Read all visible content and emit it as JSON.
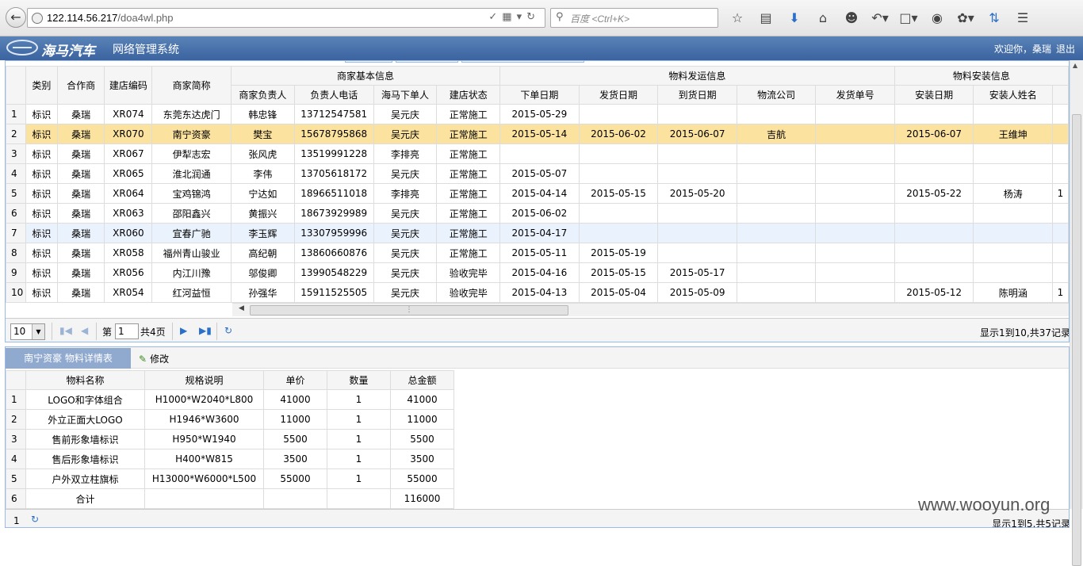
{
  "browser": {
    "url_host": "122.114.56.217",
    "url_path": "/doa4wl.php",
    "search_placeholder": "百度 <Ctrl+K>"
  },
  "header": {
    "brand": "海马汽车",
    "system_name": "网络管理系统",
    "welcome": "欢迎你，桑瑞",
    "logout": "退出"
  },
  "main_grid": {
    "group_headers": [
      "商家基本信息",
      "物料发运信息",
      "物料安装信息"
    ],
    "fixed_headers": [
      "类别",
      "合作商",
      "建店编码",
      "商家简称"
    ],
    "sub_headers": [
      "商家负责人",
      "负责人电话",
      "海马下单人",
      "建店状态",
      "下单日期",
      "发货日期",
      "到货日期",
      "物流公司",
      "发货单号",
      "安装日期",
      "安装人姓名",
      ""
    ],
    "rows": [
      [
        "1",
        "标识",
        "桑瑞",
        "XR074",
        "东莞东达虎门",
        "韩忠锋",
        "13712547581",
        "吴元庆",
        "正常施工",
        "2015-05-29",
        "",
        "",
        "",
        "",
        "",
        "",
        ""
      ],
      [
        "2",
        "标识",
        "桑瑞",
        "XR070",
        "南宁资豪",
        "樊宝",
        "15678795868",
        "吴元庆",
        "正常施工",
        "2015-05-14",
        "2015-06-02",
        "2015-06-07",
        "吉航",
        "",
        "2015-06-07",
        "王维坤",
        ""
      ],
      [
        "3",
        "标识",
        "桑瑞",
        "XR067",
        "伊犁志宏",
        "张风虎",
        "13519991228",
        "李排亮",
        "正常施工",
        "",
        "",
        "",
        "",
        "",
        "",
        "",
        ""
      ],
      [
        "4",
        "标识",
        "桑瑞",
        "XR065",
        "淮北润通",
        "李伟",
        "13705618172",
        "吴元庆",
        "正常施工",
        "2015-05-07",
        "",
        "",
        "",
        "",
        "",
        "",
        ""
      ],
      [
        "5",
        "标识",
        "桑瑞",
        "XR064",
        "宝鸡锦鸿",
        "宁达如",
        "18966511018",
        "李排亮",
        "正常施工",
        "2015-04-14",
        "2015-05-15",
        "2015-05-20",
        "",
        "",
        "2015-05-22",
        "杨涛",
        "1"
      ],
      [
        "6",
        "标识",
        "桑瑞",
        "XR063",
        "邵阳鑫兴",
        "黄振兴",
        "18673929989",
        "吴元庆",
        "正常施工",
        "2015-06-02",
        "",
        "",
        "",
        "",
        "",
        "",
        ""
      ],
      [
        "7",
        "标识",
        "桑瑞",
        "XR060",
        "宜春广驰",
        "李玉辉",
        "13307959996",
        "吴元庆",
        "正常施工",
        "2015-04-17",
        "",
        "",
        "",
        "",
        "",
        "",
        ""
      ],
      [
        "8",
        "标识",
        "桑瑞",
        "XR058",
        "福州青山骏业",
        "高纪朝",
        "13860660876",
        "吴元庆",
        "正常施工",
        "2015-05-11",
        "2015-05-19",
        "",
        "",
        "",
        "",
        "",
        ""
      ],
      [
        "9",
        "标识",
        "桑瑞",
        "XR056",
        "内江川豫",
        "邬俊卿",
        "13990548229",
        "吴元庆",
        "验收完毕",
        "2015-04-16",
        "2015-05-15",
        "2015-05-17",
        "",
        "",
        "",
        "",
        ""
      ],
      [
        "10",
        "标识",
        "桑瑞",
        "XR054",
        "红河益恒",
        "孙强华",
        "15911525505",
        "吴元庆",
        "验收完毕",
        "2015-04-13",
        "2015-05-04",
        "2015-05-09",
        "",
        "",
        "2015-05-12",
        "陈明涵",
        "1"
      ]
    ]
  },
  "pager": {
    "page_size": "10",
    "page_prefix": "第",
    "page_value": "1",
    "page_total": "共4页",
    "info": "显示1到10,共37记录"
  },
  "detail": {
    "tab_label": "南宁资豪 物料详情表",
    "edit_label": "修改",
    "headers": [
      "物料名称",
      "规格说明",
      "单价",
      "数量",
      "总金额"
    ],
    "rows": [
      [
        "1",
        "LOGO和字体组合",
        "H1000*W2040*L800",
        "41000",
        "1",
        "41000"
      ],
      [
        "2",
        "外立正面大LOGO",
        "H1946*W3600",
        "11000",
        "1",
        "11000"
      ],
      [
        "3",
        "售前形象墙标识",
        "H950*W1940",
        "5500",
        "1",
        "5500"
      ],
      [
        "4",
        "售后形象墙标识",
        "H400*W815",
        "3500",
        "1",
        "3500"
      ],
      [
        "5",
        "户外双立柱旗标",
        "H13000*W6000*L500",
        "55000",
        "1",
        "55000"
      ],
      [
        "6",
        "合计",
        "",
        "",
        "",
        "116000"
      ]
    ],
    "footer_page": "1",
    "info": "显示1到5,共5记录"
  },
  "watermark": "www.wooyun.org"
}
